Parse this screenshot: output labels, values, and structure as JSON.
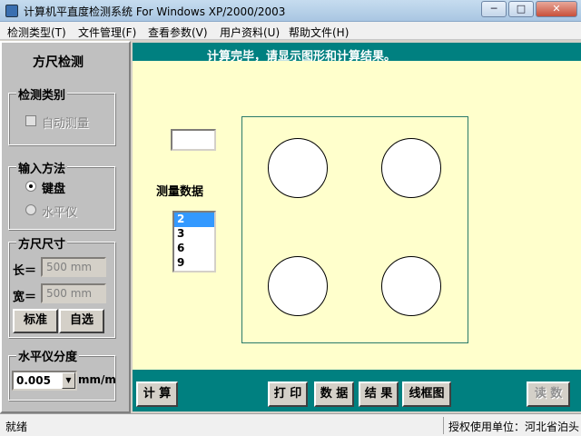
{
  "window": {
    "title": "计算机平直度检测系统   For Windows XP/2000/2003",
    "min_glyph": "─",
    "max_glyph": "□",
    "close_glyph": "✕"
  },
  "menu": [
    "检测类型(T)",
    "文件管理(F)",
    "查看参数(V)",
    "用户资料(U)",
    "帮助文件(H)"
  ],
  "left_panel": {
    "title": "方尺检测",
    "detect_type": {
      "label": "检测类别",
      "auto_measure": "自动测量",
      "auto_checked": false
    },
    "input_method": {
      "label": "输入方法",
      "keyboard": "键盘",
      "level": "水平仪",
      "selected": "keyboard"
    },
    "square_size": {
      "label": "方尺尺寸",
      "length_label": "长＝",
      "length_value": "500 mm",
      "width_label": "宽＝",
      "width_value": "500 mm",
      "standard_button": "标准",
      "custom_button": "自选"
    },
    "level_division": {
      "label": "水平仪分度",
      "value": "0.005",
      "unit": "mm/m"
    }
  },
  "main": {
    "header_message": "计算完毕，请显示图形和计算结果。",
    "input_value": "",
    "data_label": "测量数据",
    "list_items": [
      "2",
      "3",
      "6",
      "9"
    ],
    "selected_index": 0
  },
  "footer_buttons": {
    "calc": "计 算",
    "print": "打 印",
    "data": "数 据",
    "result": "结 果",
    "frame": "线框图",
    "read": "读 数"
  },
  "status": {
    "left": "就绪",
    "right": "授权使用单位：河北省泊头"
  }
}
